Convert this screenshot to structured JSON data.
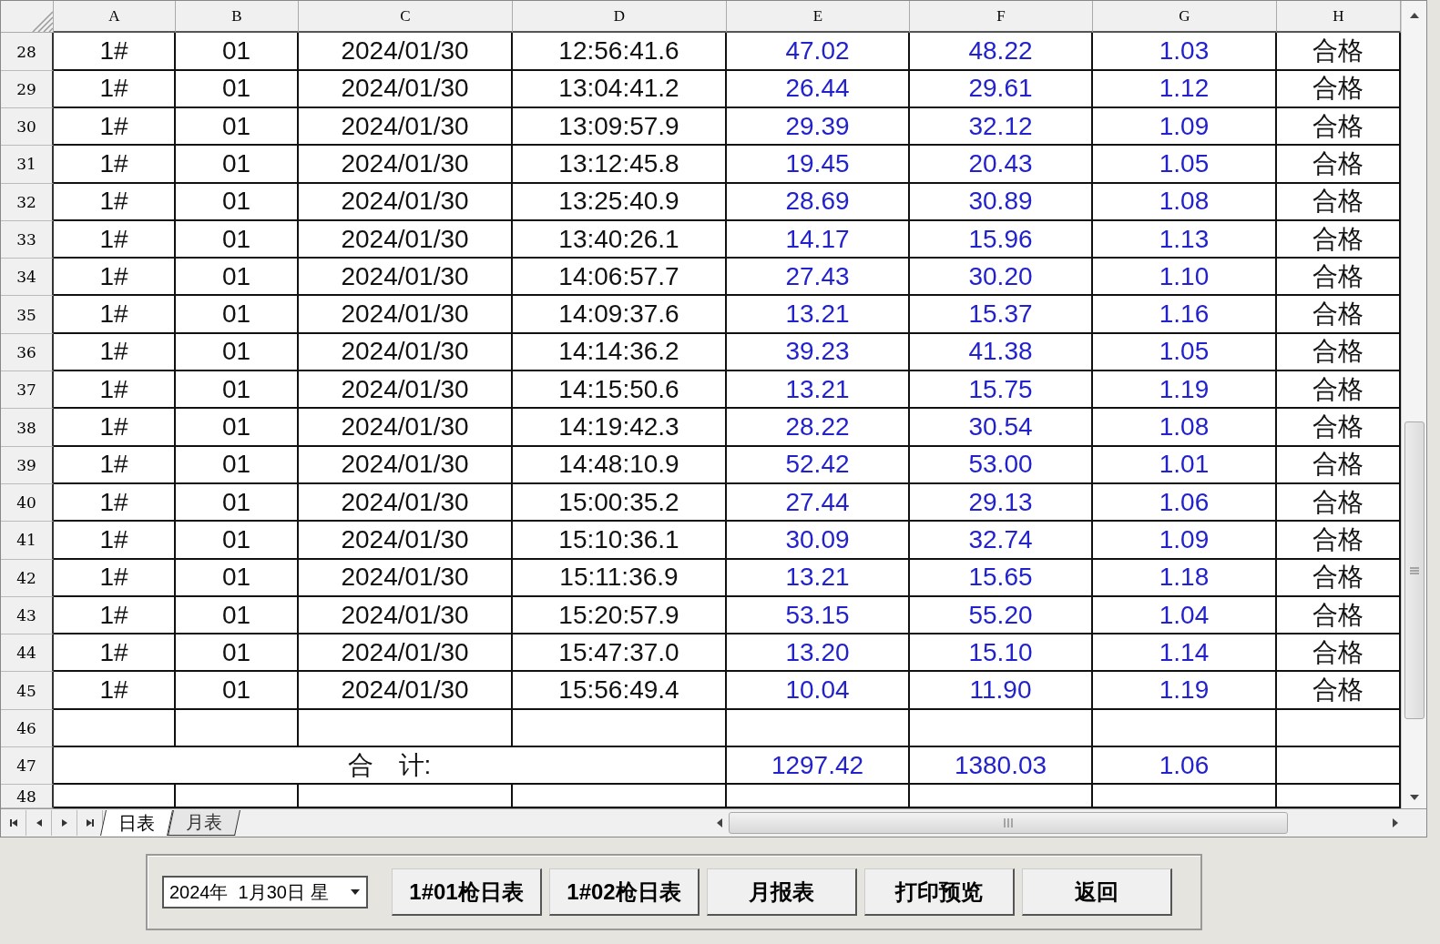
{
  "columns": [
    "A",
    "B",
    "C",
    "D",
    "E",
    "F",
    "G",
    "H"
  ],
  "rows": [
    {
      "number": "28",
      "kind": "data",
      "cells": [
        "1#",
        "01",
        "2024/01/30",
        "12:56:41.6",
        "47.02",
        "48.22",
        "1.03",
        "合格"
      ]
    },
    {
      "number": "29",
      "kind": "data",
      "cells": [
        "1#",
        "01",
        "2024/01/30",
        "13:04:41.2",
        "26.44",
        "29.61",
        "1.12",
        "合格"
      ]
    },
    {
      "number": "30",
      "kind": "data",
      "cells": [
        "1#",
        "01",
        "2024/01/30",
        "13:09:57.9",
        "29.39",
        "32.12",
        "1.09",
        "合格"
      ]
    },
    {
      "number": "31",
      "kind": "data",
      "cells": [
        "1#",
        "01",
        "2024/01/30",
        "13:12:45.8",
        "19.45",
        "20.43",
        "1.05",
        "合格"
      ]
    },
    {
      "number": "32",
      "kind": "data",
      "cells": [
        "1#",
        "01",
        "2024/01/30",
        "13:25:40.9",
        "28.69",
        "30.89",
        "1.08",
        "合格"
      ]
    },
    {
      "number": "33",
      "kind": "data",
      "cells": [
        "1#",
        "01",
        "2024/01/30",
        "13:40:26.1",
        "14.17",
        "15.96",
        "1.13",
        "合格"
      ]
    },
    {
      "number": "34",
      "kind": "data",
      "cells": [
        "1#",
        "01",
        "2024/01/30",
        "14:06:57.7",
        "27.43",
        "30.20",
        "1.10",
        "合格"
      ]
    },
    {
      "number": "35",
      "kind": "data",
      "cells": [
        "1#",
        "01",
        "2024/01/30",
        "14:09:37.6",
        "13.21",
        "15.37",
        "1.16",
        "合格"
      ]
    },
    {
      "number": "36",
      "kind": "data",
      "cells": [
        "1#",
        "01",
        "2024/01/30",
        "14:14:36.2",
        "39.23",
        "41.38",
        "1.05",
        "合格"
      ]
    },
    {
      "number": "37",
      "kind": "data",
      "cells": [
        "1#",
        "01",
        "2024/01/30",
        "14:15:50.6",
        "13.21",
        "15.75",
        "1.19",
        "合格"
      ]
    },
    {
      "number": "38",
      "kind": "data",
      "cells": [
        "1#",
        "01",
        "2024/01/30",
        "14:19:42.3",
        "28.22",
        "30.54",
        "1.08",
        "合格"
      ]
    },
    {
      "number": "39",
      "kind": "data",
      "cells": [
        "1#",
        "01",
        "2024/01/30",
        "14:48:10.9",
        "52.42",
        "53.00",
        "1.01",
        "合格"
      ]
    },
    {
      "number": "40",
      "kind": "data",
      "cells": [
        "1#",
        "01",
        "2024/01/30",
        "15:00:35.2",
        "27.44",
        "29.13",
        "1.06",
        "合格"
      ]
    },
    {
      "number": "41",
      "kind": "data",
      "cells": [
        "1#",
        "01",
        "2024/01/30",
        "15:10:36.1",
        "30.09",
        "32.74",
        "1.09",
        "合格"
      ]
    },
    {
      "number": "42",
      "kind": "data",
      "cells": [
        "1#",
        "01",
        "2024/01/30",
        "15:11:36.9",
        "13.21",
        "15.65",
        "1.18",
        "合格"
      ]
    },
    {
      "number": "43",
      "kind": "data",
      "cells": [
        "1#",
        "01",
        "2024/01/30",
        "15:20:57.9",
        "53.15",
        "55.20",
        "1.04",
        "合格"
      ]
    },
    {
      "number": "44",
      "kind": "data",
      "cells": [
        "1#",
        "01",
        "2024/01/30",
        "15:47:37.0",
        "13.20",
        "15.10",
        "1.14",
        "合格"
      ]
    },
    {
      "number": "45",
      "kind": "data",
      "cells": [
        "1#",
        "01",
        "2024/01/30",
        "15:56:49.4",
        "10.04",
        "11.90",
        "1.19",
        "合格"
      ]
    },
    {
      "number": "46",
      "kind": "blank"
    },
    {
      "number": "47",
      "kind": "total",
      "label": "合　计:",
      "values": [
        "1297.42",
        "1380.03",
        "1.06"
      ]
    },
    {
      "number": "48",
      "kind": "blank"
    }
  ],
  "sheet_tabs": [
    {
      "label": "日表",
      "selected": true
    },
    {
      "label": "月表",
      "selected": false
    }
  ],
  "date_picker": {
    "value": "2024年  1月30日 星"
  },
  "buttons": [
    "1#01枪日表",
    "1#02枪日表",
    "月报表",
    "打印预览",
    "返回"
  ]
}
